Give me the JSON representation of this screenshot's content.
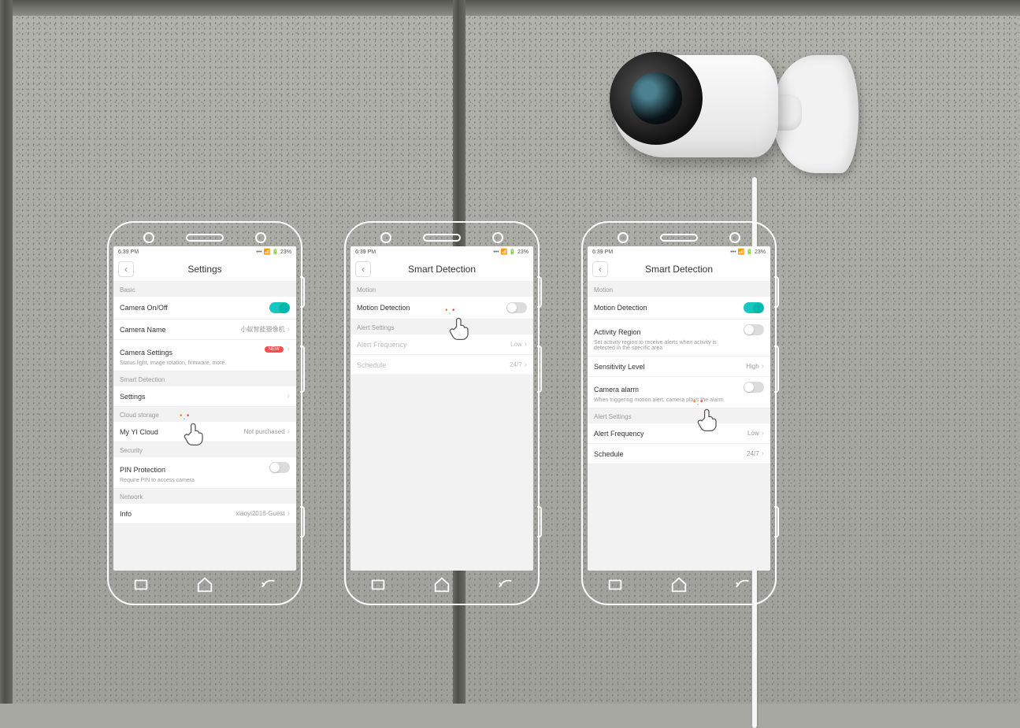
{
  "status": {
    "time": "6:39  PM",
    "battery": "23%"
  },
  "phone1": {
    "title": "Settings",
    "sections": {
      "basic": "Basic",
      "smart": "Smart Detection",
      "cloud": "Cloud storage",
      "security": "Security",
      "network": "Network"
    },
    "rows": {
      "cameraOnOff": "Camera On/Off",
      "cameraName": {
        "label": "Camera Name",
        "value": "小蚁智能摄像机"
      },
      "cameraSettings": {
        "label": "Camera Settings",
        "sub": "Status light, image rotation, firmware, more.",
        "badge": "NEW"
      },
      "settings": "Settings",
      "cloud": {
        "label": "My YI Cloud",
        "value": "Not purchased"
      },
      "pin": {
        "label": "PIN Protection",
        "sub": "Require PIN to access camera"
      },
      "info": {
        "label": "Info",
        "value": "xiaoyi2016-Guest"
      }
    }
  },
  "phone2": {
    "title": "Smart Detection",
    "sections": {
      "motion": "Motion",
      "alert": "Alert Settings"
    },
    "rows": {
      "motionDetection": "Motion Detection",
      "alertFreq": {
        "label": "Alert Frequency",
        "value": "Low"
      },
      "schedule": {
        "label": "Schedule",
        "value": "24/7"
      }
    }
  },
  "phone3": {
    "title": "Smart Detection",
    "sections": {
      "motion": "Motion",
      "alert": "Alert Settings"
    },
    "rows": {
      "motionDetection": "Motion Detection",
      "activityRegion": {
        "label": "Activity Region",
        "sub": "Set activity region to receive alerts when activity is detected in the specific area"
      },
      "sensitivity": {
        "label": "Sensitivity Level",
        "value": "High"
      },
      "cameraAlarm": {
        "label": "Camera alarm",
        "sub": "When triggering motion alert, camera plays the alarm"
      },
      "alertFreq": {
        "label": "Alert Frequency",
        "value": "Low"
      },
      "schedule": {
        "label": "Schedule",
        "value": "24/7"
      }
    }
  }
}
